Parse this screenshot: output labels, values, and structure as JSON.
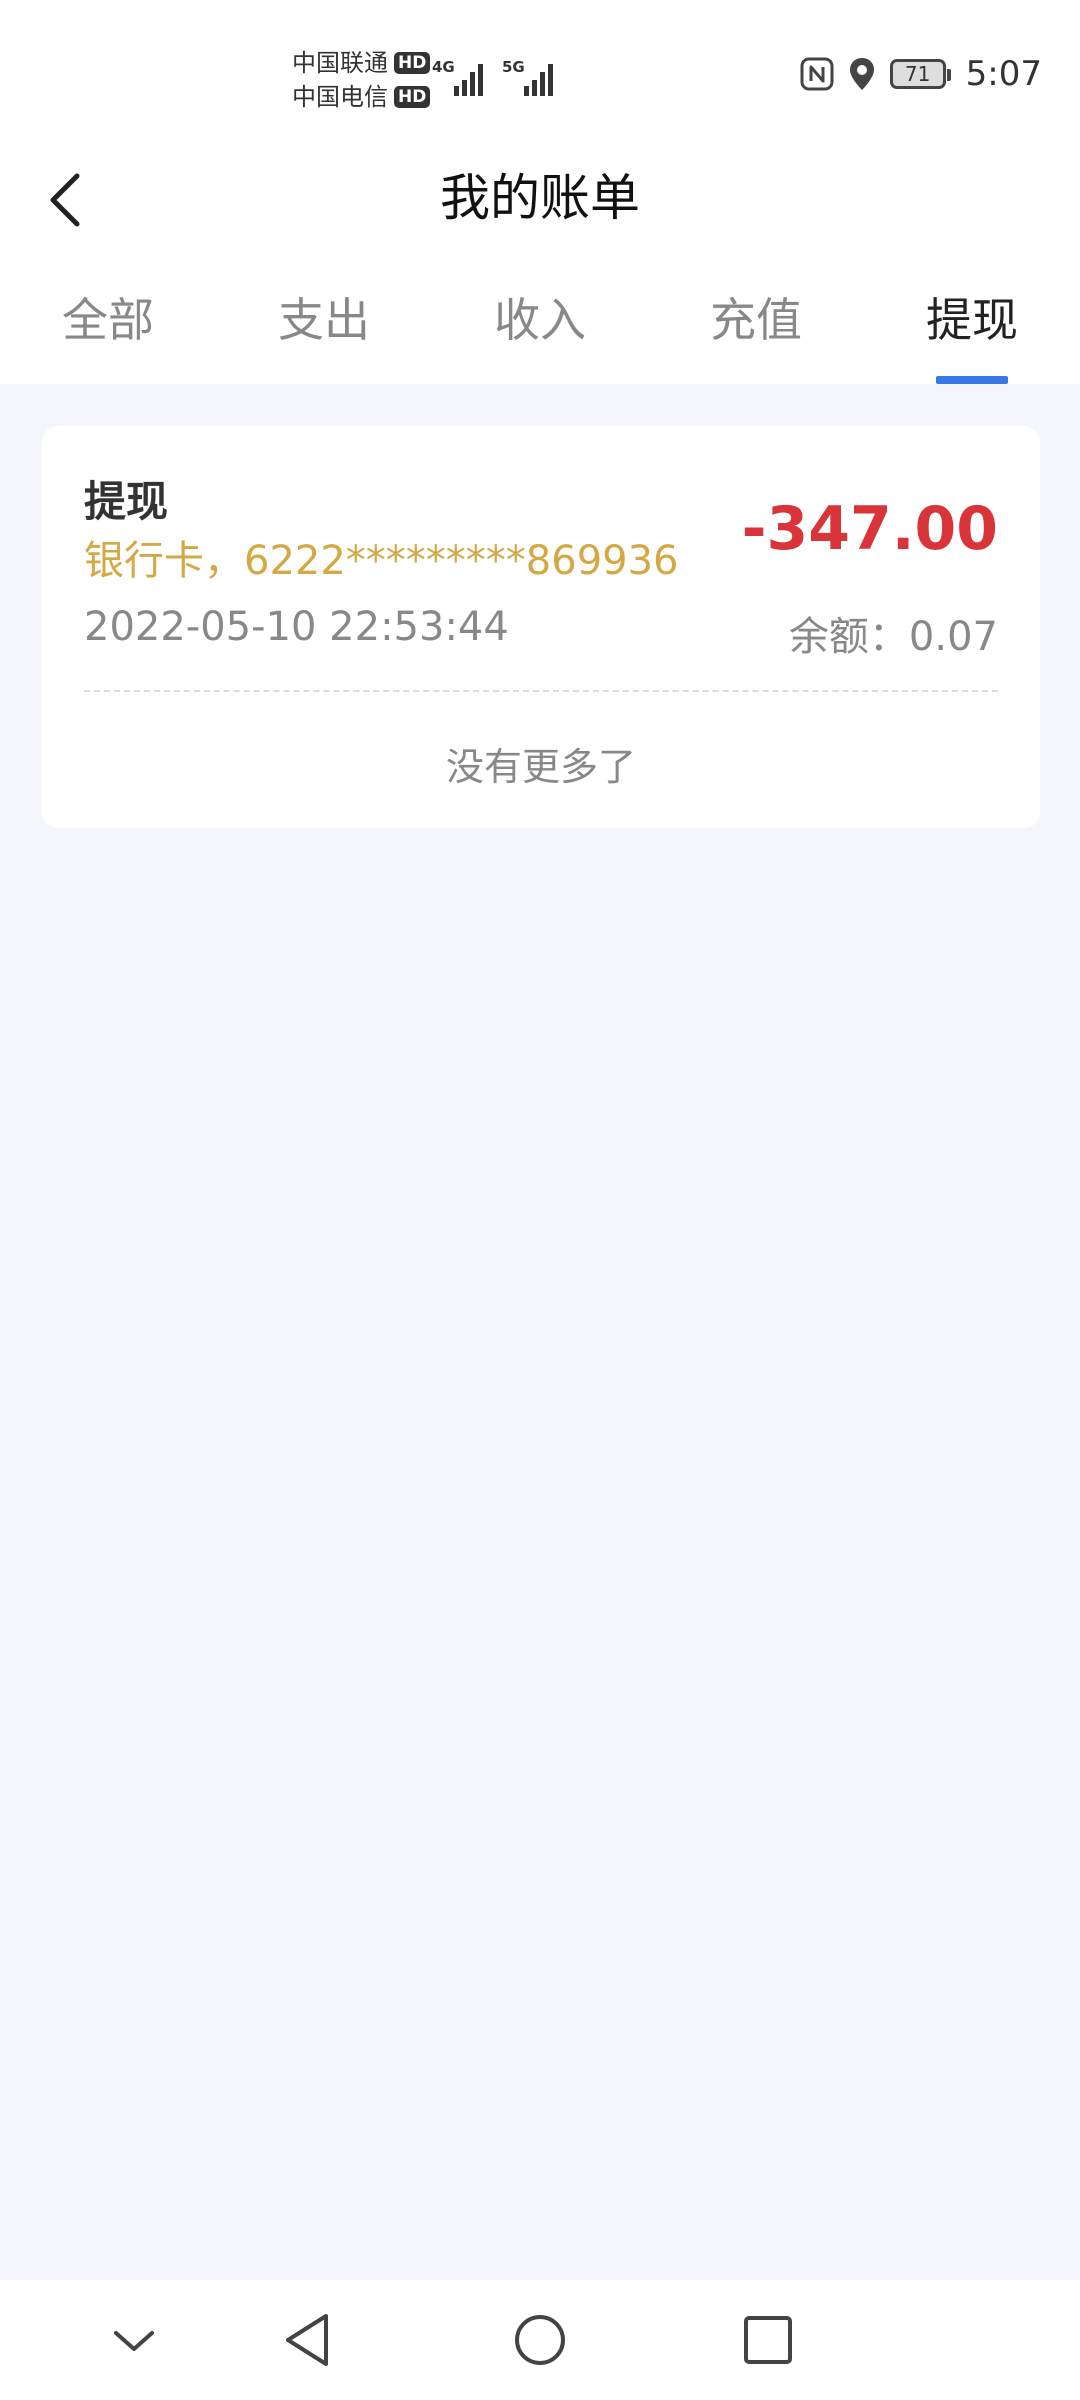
{
  "status_bar": {
    "carrier_1": "中国联通",
    "carrier_2": "中国电信",
    "hd_badge": "HD",
    "network_1": "4G",
    "network_2": "5G",
    "battery_level": "71",
    "time": "5:07",
    "icons": [
      "nfc-icon",
      "location-icon",
      "battery-icon",
      "signal-icon"
    ]
  },
  "header": {
    "title": "我的账单",
    "back_icon": "chevron-left-icon"
  },
  "tabs": [
    {
      "label": "全部",
      "active": false
    },
    {
      "label": "支出",
      "active": false
    },
    {
      "label": "收入",
      "active": false
    },
    {
      "label": "充值",
      "active": false
    },
    {
      "label": "提现",
      "active": true
    }
  ],
  "transactions": [
    {
      "title": "提现",
      "account": "银行卡，6222*********869936",
      "amount": "-347.00",
      "time": "2022-05-10 22:53:44",
      "balance": "余额：0.07"
    }
  ],
  "list_footer": "没有更多了",
  "nav_bar": {
    "icons": [
      "chevron-down-icon",
      "back-triangle-icon",
      "home-circle-icon",
      "recents-square-icon"
    ]
  },
  "colors": {
    "accent": "#3a78e6",
    "amount": "#d9343a",
    "account": "#d3a845",
    "background": "#f4f6fb"
  }
}
